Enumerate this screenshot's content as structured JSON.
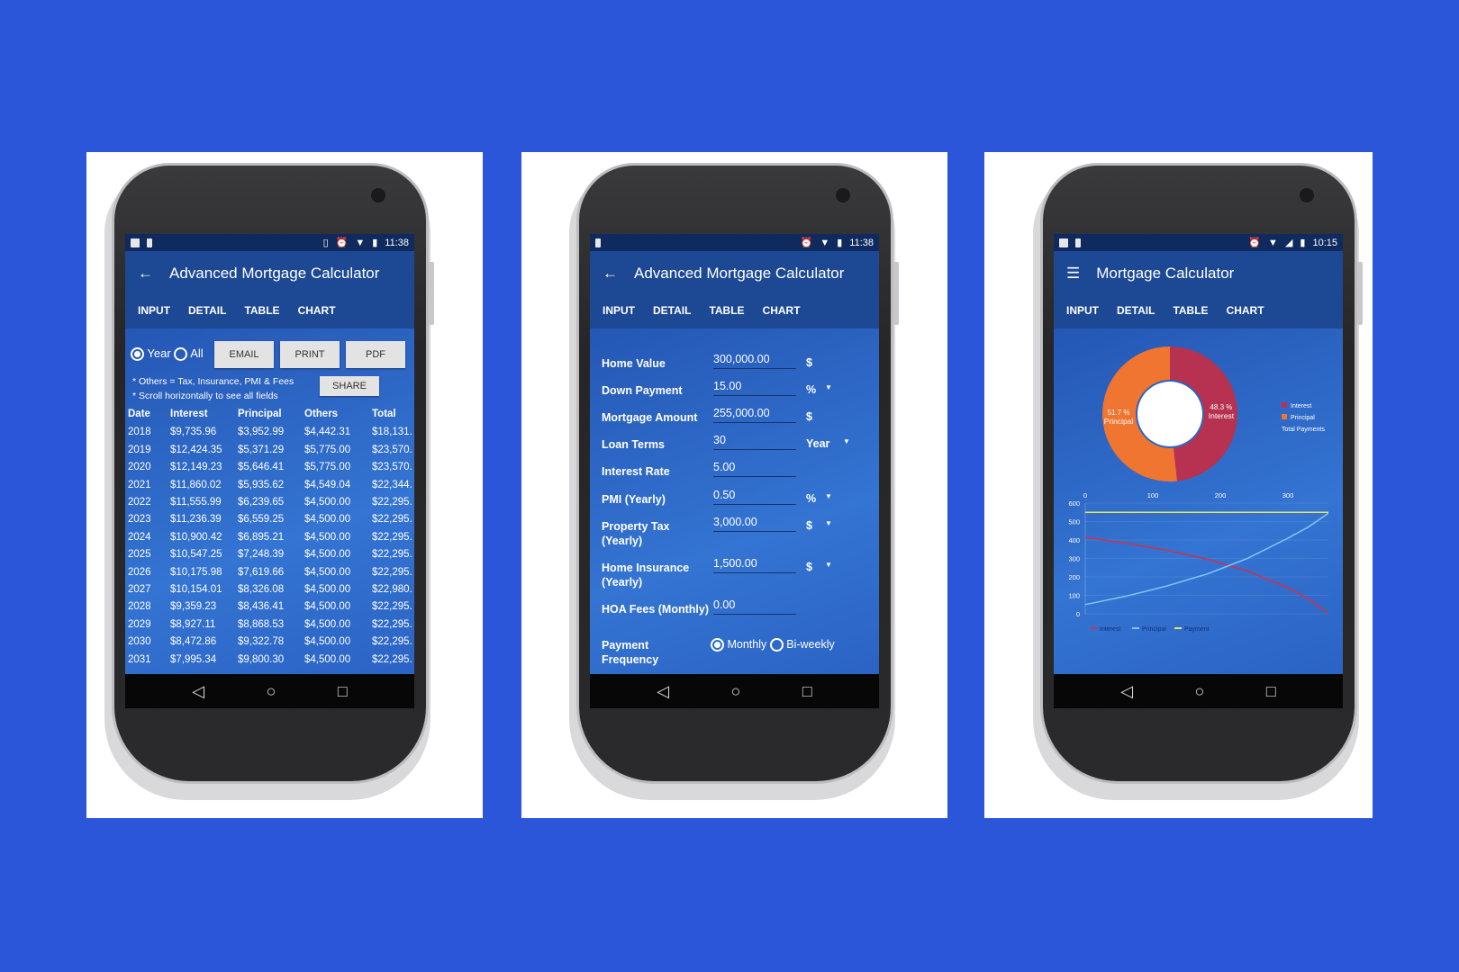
{
  "colors": {
    "background": "#2c56d9",
    "app_bar": "#1c4894",
    "tab_indicator": "#3b9cf5",
    "interest": "#b73250",
    "principal": "#ef7530",
    "payment": "#e6e85a",
    "principal_line": "#7fc3f0"
  },
  "status_left_icons": [
    "image-icon",
    "usb-icon"
  ],
  "nav_icons": [
    "back-triangle-icon",
    "home-circle-icon",
    "recents-square-icon"
  ],
  "nav": {
    "back": "◁",
    "home": "○",
    "recents": "□"
  },
  "tabs": [
    "INPUT",
    "DETAIL",
    "TABLE",
    "CHART"
  ],
  "phone1": {
    "time": "11:38",
    "title": "Advanced Mortgage Calculator",
    "active_tab": "TABLE",
    "radio_year": "Year",
    "radio_all": "All",
    "selected": "Year",
    "buttons": {
      "email": "EMAIL",
      "print": "PRINT",
      "pdf": "PDF",
      "share": "SHARE"
    },
    "notes": [
      "* Others = Tax, Insurance, PMI & Fees",
      "* Scroll horizontally to see all fields"
    ],
    "columns": [
      "Date",
      "Interest",
      "Principal",
      "Others",
      "Total"
    ],
    "rows": [
      [
        "2018",
        "$9,735.96",
        "$3,952.99",
        "$4,442.31",
        "$18,131."
      ],
      [
        "2019",
        "$12,424.35",
        "$5,371.29",
        "$5,775.00",
        "$23,570."
      ],
      [
        "2020",
        "$12,149.23",
        "$5,646.41",
        "$5,775.00",
        "$23,570."
      ],
      [
        "2021",
        "$11,860.02",
        "$5,935.62",
        "$4,549.04",
        "$22,344."
      ],
      [
        "2022",
        "$11,555.99",
        "$6,239.65",
        "$4,500.00",
        "$22,295."
      ],
      [
        "2023",
        "$11,236.39",
        "$6,559.25",
        "$4,500.00",
        "$22,295."
      ],
      [
        "2024",
        "$10,900.42",
        "$6,895.21",
        "$4,500.00",
        "$22,295."
      ],
      [
        "2025",
        "$10,547.25",
        "$7,248.39",
        "$4,500.00",
        "$22,295."
      ],
      [
        "2026",
        "$10,175.98",
        "$7,619.66",
        "$4,500.00",
        "$22,295."
      ],
      [
        "2027",
        "$10,154.01",
        "$8,326.08",
        "$4,500.00",
        "$22,980."
      ],
      [
        "2028",
        "$9,359.23",
        "$8,436.41",
        "$4,500.00",
        "$22,295."
      ],
      [
        "2029",
        "$8,927.11",
        "$8,868.53",
        "$4,500.00",
        "$22,295."
      ],
      [
        "2030",
        "$8,472.86",
        "$9,322.78",
        "$4,500.00",
        "$22,295."
      ],
      [
        "2031",
        "$7,995.34",
        "$9,800.30",
        "$4,500.00",
        "$22,295."
      ]
    ]
  },
  "phone2": {
    "time": "11:38",
    "title": "Advanced Mortgage Calculator",
    "active_tab": "INPUT",
    "fields": [
      {
        "label": "Home Value",
        "value": "300,000.00",
        "unit": "$",
        "dropdown": false
      },
      {
        "label": "Down Payment",
        "value": "15.00",
        "unit": "%",
        "dropdown": true
      },
      {
        "label": "Mortgage Amount",
        "value": "255,000.00",
        "unit": "$",
        "dropdown": false
      },
      {
        "label": "Loan Terms",
        "value": "30",
        "unit": "Year",
        "dropdown": true
      },
      {
        "label": "Interest Rate",
        "value": "5.00",
        "unit": "",
        "dropdown": false
      },
      {
        "label": "PMI (Yearly)",
        "value": "0.50",
        "unit": "%",
        "dropdown": true
      },
      {
        "label": "Property Tax (Yearly)",
        "value": "3,000.00",
        "unit": "$",
        "dropdown": true
      },
      {
        "label": "Home Insurance (Yearly)",
        "value": "1,500.00",
        "unit": "$",
        "dropdown": true
      },
      {
        "label": "HOA Fees (Monthly)",
        "value": "0.00",
        "unit": "",
        "dropdown": false
      }
    ],
    "frequency": {
      "label": "Payment Frequency",
      "options": [
        "Monthly",
        "Bi-weekly"
      ],
      "selected": "Monthly"
    }
  },
  "phone3": {
    "time": "10:15",
    "title": "Mortgage Calculator",
    "active_tab": "CHART"
  },
  "chart_data": [
    {
      "type": "pie",
      "donut": true,
      "slices": [
        {
          "name": "Interest",
          "value": 48.3,
          "label": "48.3 %",
          "sublabel": "Interest",
          "color": "#b73250"
        },
        {
          "name": "Principal",
          "value": 51.7,
          "label": "51.7 %",
          "sublabel": "Principal",
          "color": "#ef7530"
        }
      ],
      "legend": [
        "Interest",
        "Principal"
      ],
      "legend_title": "Total Payments",
      "legend_placement": "right"
    },
    {
      "type": "line",
      "x_ticks": [
        0,
        100,
        200,
        300
      ],
      "y_ticks": [
        0,
        100,
        200,
        300,
        400,
        500,
        600
      ],
      "xlim": [
        0,
        360
      ],
      "ylim": [
        0,
        600
      ],
      "x_axis_position": "top",
      "grid": true,
      "legend_placement": "bottom",
      "series": [
        {
          "name": "Interest",
          "color": "#c8354f",
          "x": [
            0,
            60,
            120,
            180,
            240,
            300,
            330,
            360
          ],
          "y": [
            415,
            383,
            345,
            297,
            232,
            142,
            80,
            3
          ]
        },
        {
          "name": "Principal",
          "color": "#7fc3f0",
          "x": [
            0,
            60,
            120,
            180,
            240,
            300,
            330,
            360
          ],
          "y": [
            50,
            95,
            150,
            215,
            300,
            410,
            470,
            545
          ]
        },
        {
          "name": "Payment",
          "color": "#e6e85a",
          "x": [
            0,
            360
          ],
          "y": [
            550,
            550
          ]
        }
      ]
    }
  ]
}
